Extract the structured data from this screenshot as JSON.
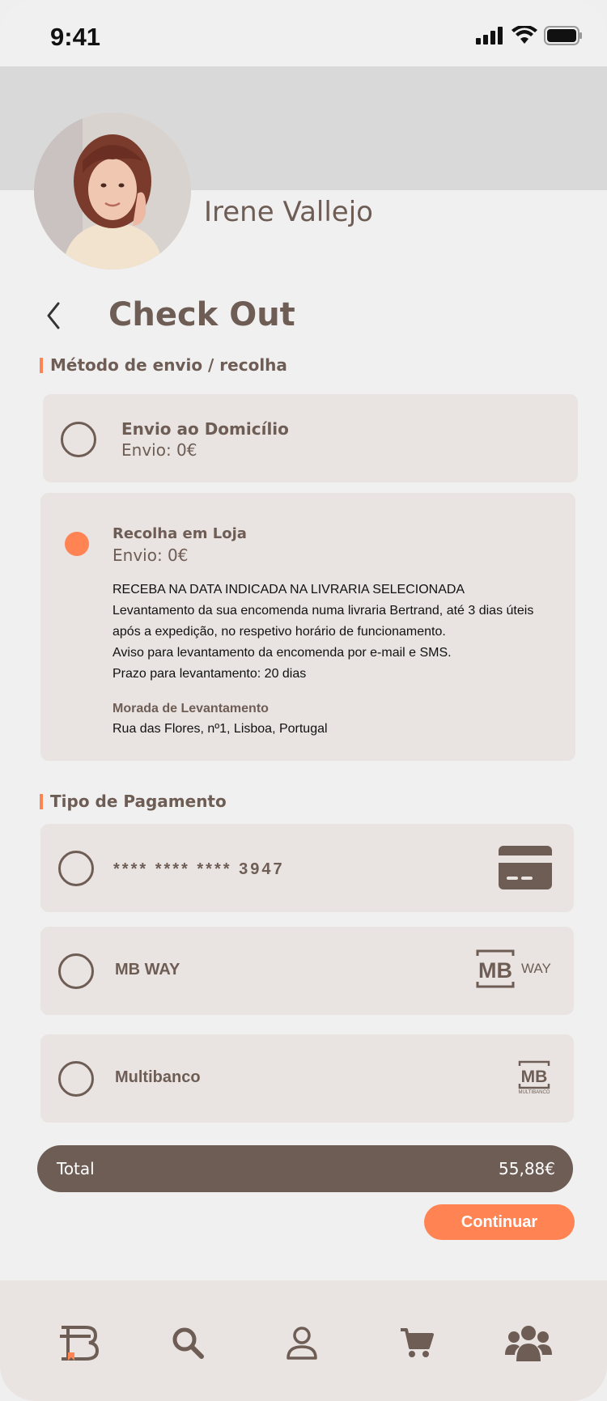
{
  "status_bar": {
    "time": "9:41"
  },
  "profile": {
    "name": "Irene Vallejo"
  },
  "page": {
    "title": "Check Out"
  },
  "shipping": {
    "section_title": "Método de envio / recolha",
    "options": [
      {
        "title": "Envio ao Domicílio",
        "subtitle": "Envio: 0€",
        "selected": false
      },
      {
        "title": "Recolha em Loja",
        "subtitle": "Envio: 0€",
        "selected": true
      }
    ],
    "pickup_details": [
      "RECEBA NA DATA INDICADA NA LIVRARIA SELECIONADA",
      "Levantamento da sua encomenda numa livraria Bertrand, até 3 dias úteis",
      "após a expedição, no respetivo horário de funcionamento.",
      "Aviso para levantamento da encomenda por e-mail e SMS.",
      "Prazo para levantamento: 20 dias"
    ],
    "address_label": "Morada de Levantamento",
    "address_value": "Rua das Flores, nº1, Lisboa, Portugal"
  },
  "payment": {
    "section_title": "Tipo de Pagamento",
    "options": [
      {
        "label": "**** **** **** 3947",
        "icon": "credit-card-icon"
      },
      {
        "label": "MB WAY",
        "icon": "mbway-logo",
        "logo_text": "WAY"
      },
      {
        "label": "Multibanco",
        "icon": "multibanco-logo",
        "logo_text": "MULTIBANCO"
      }
    ]
  },
  "total": {
    "label": "Total",
    "value": "55,88€"
  },
  "actions": {
    "continue_label": "Continuar"
  },
  "bottom_nav": [
    {
      "icon": "home-logo-icon",
      "active": true
    },
    {
      "icon": "search-icon"
    },
    {
      "icon": "profile-icon"
    },
    {
      "icon": "cart-icon"
    },
    {
      "icon": "community-icon"
    }
  ],
  "colors": {
    "brown": "#6e5d55",
    "accent": "#ff8353",
    "card": "#e9e4e1",
    "background": "#f1f0f0",
    "header": "#d9d9d9"
  }
}
